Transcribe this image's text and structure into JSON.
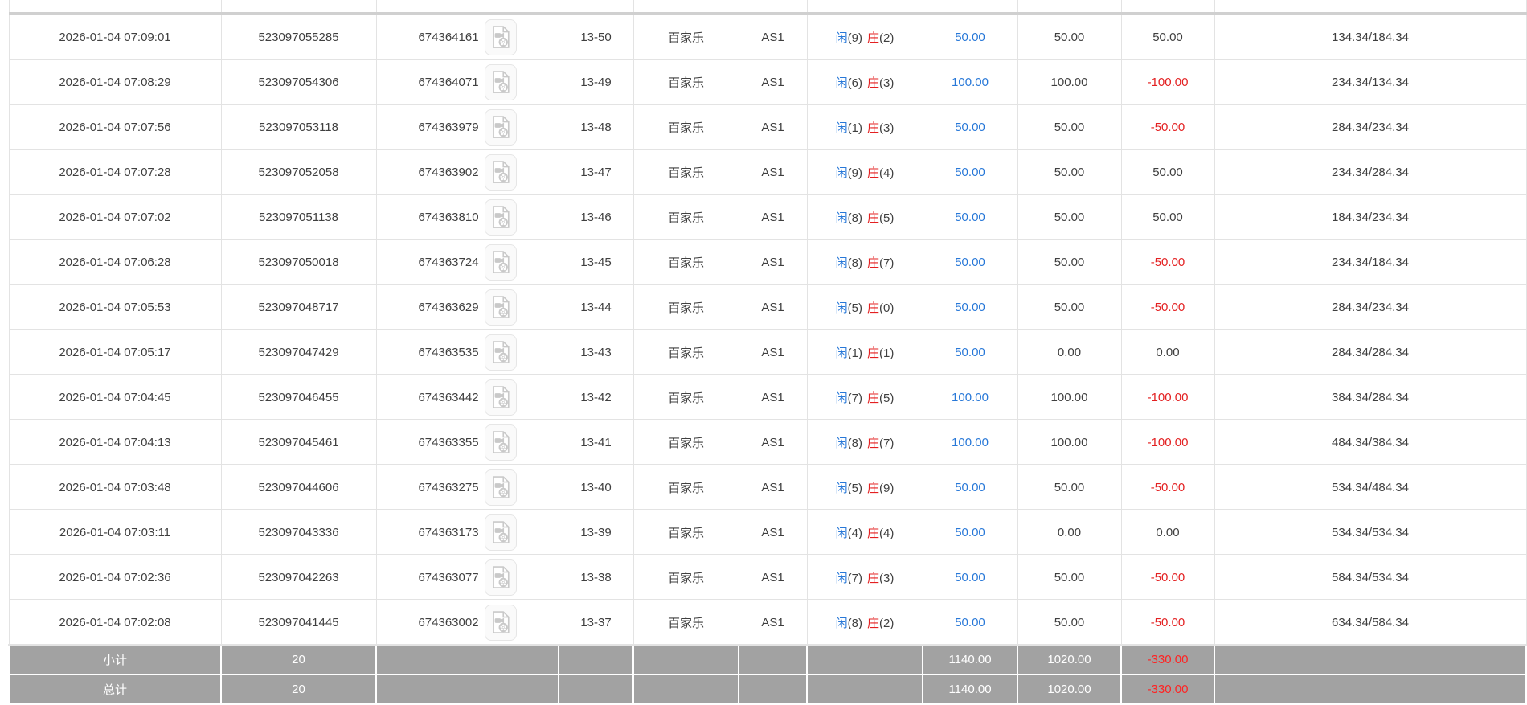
{
  "table": {
    "game_name": "百家乐",
    "table_code": "AS1",
    "rows": [
      {
        "time": "2026-01-04 07:09:01",
        "order_id": "523097055285",
        "game_id": "674364161",
        "round": "13-50",
        "game": "百家乐",
        "table": "AS1",
        "player_label": "闲",
        "player_num": "(9)",
        "banker_label": "庄",
        "banker_num": "(2)",
        "bet": "50.00",
        "valid": "50.00",
        "winloss": "50.00",
        "balance": "134.34/184.34"
      },
      {
        "time": "2026-01-04 07:08:29",
        "order_id": "523097054306",
        "game_id": "674364071",
        "round": "13-49",
        "game": "百家乐",
        "table": "AS1",
        "player_label": "闲",
        "player_num": "(6)",
        "banker_label": "庄",
        "banker_num": "(3)",
        "bet": "100.00",
        "valid": "100.00",
        "winloss": "-100.00",
        "balance": "234.34/134.34"
      },
      {
        "time": "2026-01-04 07:07:56",
        "order_id": "523097053118",
        "game_id": "674363979",
        "round": "13-48",
        "game": "百家乐",
        "table": "AS1",
        "player_label": "闲",
        "player_num": "(1)",
        "banker_label": "庄",
        "banker_num": "(3)",
        "bet": "50.00",
        "valid": "50.00",
        "winloss": "-50.00",
        "balance": "284.34/234.34"
      },
      {
        "time": "2026-01-04 07:07:28",
        "order_id": "523097052058",
        "game_id": "674363902",
        "round": "13-47",
        "game": "百家乐",
        "table": "AS1",
        "player_label": "闲",
        "player_num": "(9)",
        "banker_label": "庄",
        "banker_num": "(4)",
        "bet": "50.00",
        "valid": "50.00",
        "winloss": "50.00",
        "balance": "234.34/284.34"
      },
      {
        "time": "2026-01-04 07:07:02",
        "order_id": "523097051138",
        "game_id": "674363810",
        "round": "13-46",
        "game": "百家乐",
        "table": "AS1",
        "player_label": "闲",
        "player_num": "(8)",
        "banker_label": "庄",
        "banker_num": "(5)",
        "bet": "50.00",
        "valid": "50.00",
        "winloss": "50.00",
        "balance": "184.34/234.34"
      },
      {
        "time": "2026-01-04 07:06:28",
        "order_id": "523097050018",
        "game_id": "674363724",
        "round": "13-45",
        "game": "百家乐",
        "table": "AS1",
        "player_label": "闲",
        "player_num": "(8)",
        "banker_label": "庄",
        "banker_num": "(7)",
        "bet": "50.00",
        "valid": "50.00",
        "winloss": "-50.00",
        "balance": "234.34/184.34"
      },
      {
        "time": "2026-01-04 07:05:53",
        "order_id": "523097048717",
        "game_id": "674363629",
        "round": "13-44",
        "game": "百家乐",
        "table": "AS1",
        "player_label": "闲",
        "player_num": "(5)",
        "banker_label": "庄",
        "banker_num": "(0)",
        "bet": "50.00",
        "valid": "50.00",
        "winloss": "-50.00",
        "balance": "284.34/234.34"
      },
      {
        "time": "2026-01-04 07:05:17",
        "order_id": "523097047429",
        "game_id": "674363535",
        "round": "13-43",
        "game": "百家乐",
        "table": "AS1",
        "player_label": "闲",
        "player_num": "(1)",
        "banker_label": "庄",
        "banker_num": "(1)",
        "bet": "50.00",
        "valid": "0.00",
        "winloss": "0.00",
        "balance": "284.34/284.34"
      },
      {
        "time": "2026-01-04 07:04:45",
        "order_id": "523097046455",
        "game_id": "674363442",
        "round": "13-42",
        "game": "百家乐",
        "table": "AS1",
        "player_label": "闲",
        "player_num": "(7)",
        "banker_label": "庄",
        "banker_num": "(5)",
        "bet": "100.00",
        "valid": "100.00",
        "winloss": "-100.00",
        "balance": "384.34/284.34"
      },
      {
        "time": "2026-01-04 07:04:13",
        "order_id": "523097045461",
        "game_id": "674363355",
        "round": "13-41",
        "game": "百家乐",
        "table": "AS1",
        "player_label": "闲",
        "player_num": "(8)",
        "banker_label": "庄",
        "banker_num": "(7)",
        "bet": "100.00",
        "valid": "100.00",
        "winloss": "-100.00",
        "balance": "484.34/384.34"
      },
      {
        "time": "2026-01-04 07:03:48",
        "order_id": "523097044606",
        "game_id": "674363275",
        "round": "13-40",
        "game": "百家乐",
        "table": "AS1",
        "player_label": "闲",
        "player_num": "(5)",
        "banker_label": "庄",
        "banker_num": "(9)",
        "bet": "50.00",
        "valid": "50.00",
        "winloss": "-50.00",
        "balance": "534.34/484.34"
      },
      {
        "time": "2026-01-04 07:03:11",
        "order_id": "523097043336",
        "game_id": "674363173",
        "round": "13-39",
        "game": "百家乐",
        "table": "AS1",
        "player_label": "闲",
        "player_num": "(4)",
        "banker_label": "庄",
        "banker_num": "(4)",
        "bet": "50.00",
        "valid": "0.00",
        "winloss": "0.00",
        "balance": "534.34/534.34"
      },
      {
        "time": "2026-01-04 07:02:36",
        "order_id": "523097042263",
        "game_id": "674363077",
        "round": "13-38",
        "game": "百家乐",
        "table": "AS1",
        "player_label": "闲",
        "player_num": "(7)",
        "banker_label": "庄",
        "banker_num": "(3)",
        "bet": "50.00",
        "valid": "50.00",
        "winloss": "-50.00",
        "balance": "584.34/534.34"
      },
      {
        "time": "2026-01-04 07:02:08",
        "order_id": "523097041445",
        "game_id": "674363002",
        "round": "13-37",
        "game": "百家乐",
        "table": "AS1",
        "player_label": "闲",
        "player_num": "(8)",
        "banker_label": "庄",
        "banker_num": "(2)",
        "bet": "50.00",
        "valid": "50.00",
        "winloss": "-50.00",
        "balance": "634.34/584.34"
      }
    ],
    "footer_rows": [
      {
        "label": "小计",
        "count": "20",
        "bet": "1140.00",
        "valid": "1020.00",
        "winloss": "-330.00"
      },
      {
        "label": "总计",
        "count": "20",
        "bet": "1140.00",
        "valid": "1020.00",
        "winloss": "-330.00"
      }
    ],
    "colors": {
      "player_blue": "#2878d8",
      "banker_red": "#e32021",
      "negative_red": "#e32021",
      "footer_bg": "#a2a2a2",
      "border": "#e3e3e3"
    },
    "icons": {
      "video_icon": "video-record-file"
    }
  }
}
